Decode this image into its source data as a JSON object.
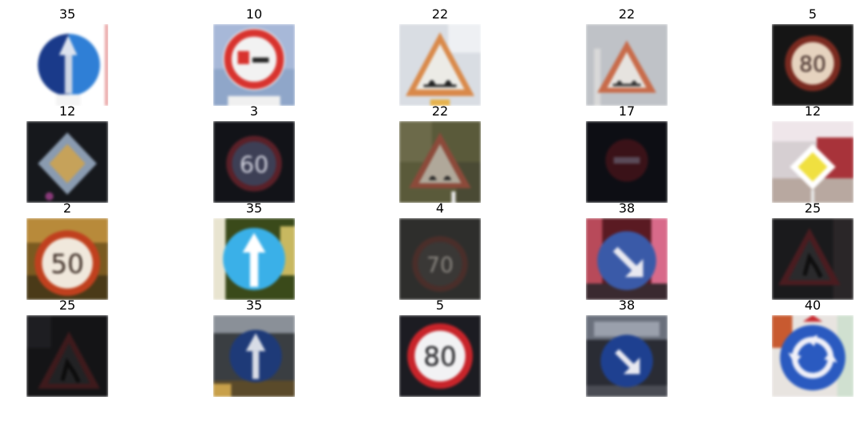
{
  "grid": {
    "labels": [
      [
        "35",
        "10",
        "22",
        "22",
        "5"
      ],
      [
        "12",
        "3",
        "22",
        "17",
        "12"
      ],
      [
        "2",
        "35",
        "4",
        "38",
        "25"
      ],
      [
        "25",
        "35",
        "5",
        "38",
        "40"
      ]
    ]
  },
  "sign_texts": {
    "r0c4": "80",
    "r1c1": "60",
    "r2c0": "50",
    "r2c2": "70",
    "r3c2": "80"
  }
}
